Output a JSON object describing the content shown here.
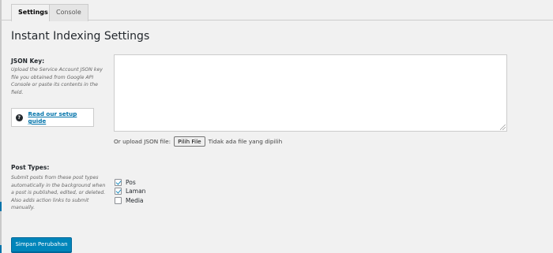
{
  "tabs": [
    {
      "label": "Settings",
      "active": true
    },
    {
      "label": "Console",
      "active": false
    }
  ],
  "page_title": "Instant Indexing Settings",
  "json_key": {
    "heading": "JSON Key:",
    "description": "Upload the Service Account JSON key file you obtained from Google API Console or paste its contents in the field.",
    "guide_link": "Read our setup guide",
    "textarea_value": "",
    "upload_label": "Or upload JSON file:",
    "file_button": "Pilih File",
    "file_status": "Tidak ada file yang dipilih"
  },
  "post_types": {
    "heading": "Post Types:",
    "description": "Submit posts from these post types automatically in the background when a post is published, edited, or deleted. Also adds action links to submit manually.",
    "options": [
      {
        "label": "Pos",
        "checked": true
      },
      {
        "label": "Laman",
        "checked": true
      },
      {
        "label": "Media",
        "checked": false
      }
    ]
  },
  "save_button": "Simpan Perubahan",
  "colors": {
    "accent": "#0085ba",
    "link": "#0073aa",
    "background": "#f1f1f1"
  },
  "icons": {
    "guide_icon": "question-circle-icon"
  }
}
